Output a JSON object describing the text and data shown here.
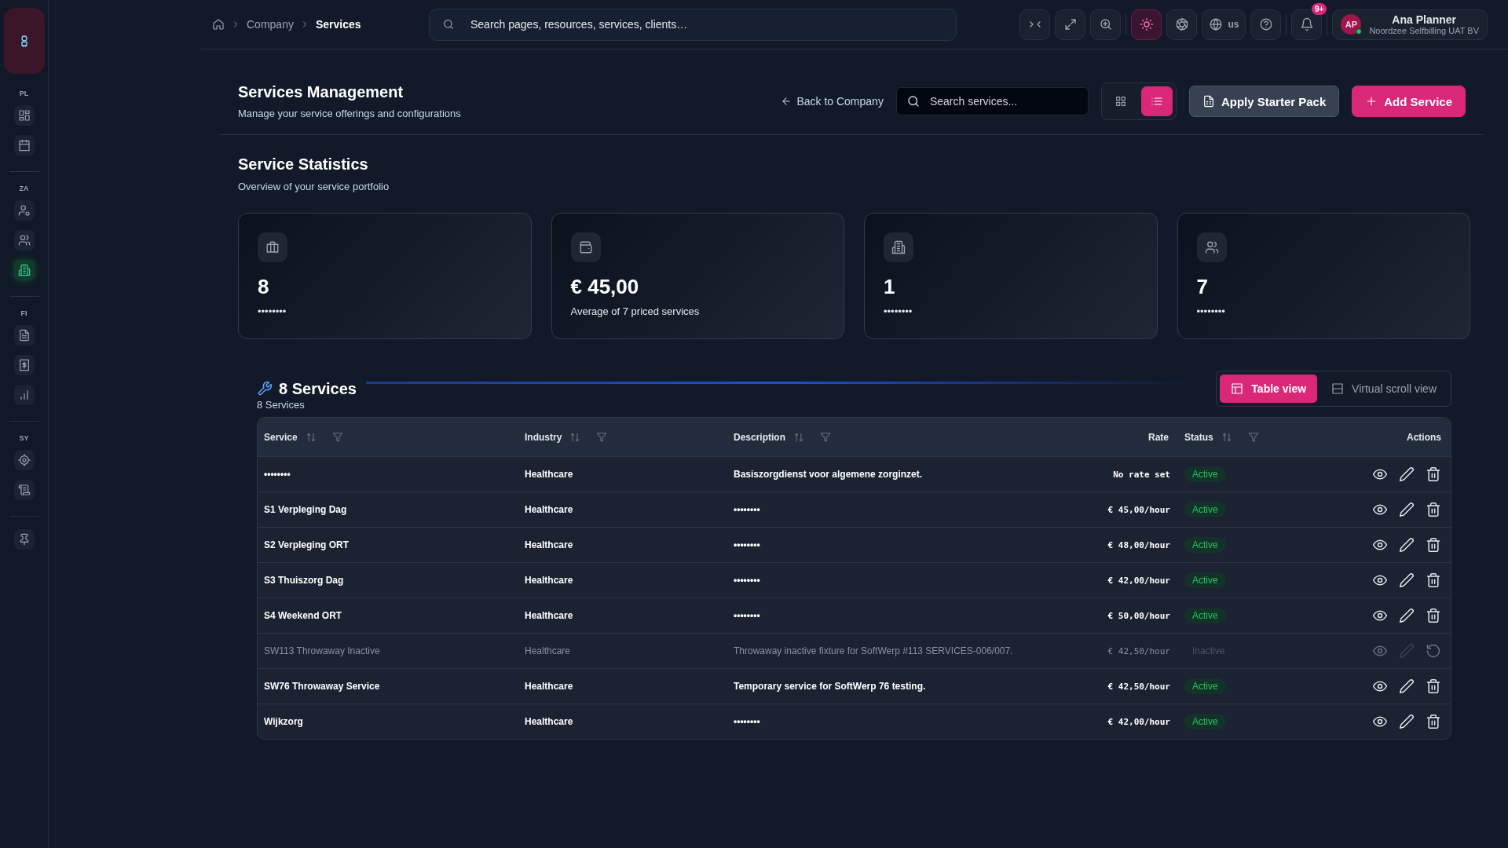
{
  "sidebar": {
    "sections": [
      {
        "label": "PL",
        "items": [
          {
            "selected": false
          },
          {
            "selected": false
          }
        ]
      },
      {
        "label": "ZA",
        "items": [
          {
            "selected": false
          },
          {
            "selected": false
          },
          {
            "selected": true
          }
        ]
      },
      {
        "label": "FI",
        "items": [
          {
            "selected": false
          },
          {
            "selected": false
          },
          {
            "selected": false
          }
        ]
      },
      {
        "label": "SY",
        "items": [
          {
            "selected": false
          },
          {
            "selected": false
          }
        ]
      }
    ]
  },
  "topbar": {
    "breadcrumb": [
      "Company",
      "Services"
    ],
    "search": {
      "placeholder": "Search pages, resources, services, clients…"
    },
    "theme_toggle": {
      "on": true
    },
    "language": "us",
    "notifications_badge": "9+",
    "user": {
      "initials": "AP",
      "name": "Ana Planner",
      "organization": "Noordzee Selfbilling UAT BV"
    }
  },
  "page_header": {
    "title": "Services Management",
    "subtitle": "Manage your service offerings and configurations",
    "back_link": "Back to Company",
    "search": {
      "placeholder": "Search services..."
    },
    "view_modes": [
      {
        "selected": false
      },
      {
        "selected": true
      }
    ],
    "buttons": [
      "Apply Starter Pack",
      "Add Service"
    ]
  },
  "statistics": {
    "title": "Service Statistics",
    "subtitle": "Overview of your service portfolio",
    "cards": [
      {
        "value": "8",
        "label": "••••••••"
      },
      {
        "value": "€ 45,00",
        "label": "Average of 7 priced services"
      },
      {
        "value": "1",
        "label": "••••••••"
      },
      {
        "value": "7",
        "label": "••••••••"
      }
    ]
  },
  "services": {
    "title": "8 Services",
    "subtitle": "8 Services",
    "views": [
      {
        "label": "Table view",
        "selected": true
      },
      {
        "label": "Virtual scroll view",
        "selected": false
      }
    ],
    "table": {
      "columns": [
        {
          "label": "Service",
          "sortable": true
        },
        {
          "label": "Industry",
          "sortable": true
        },
        {
          "label": "Description",
          "sortable": true
        },
        {
          "label": "Rate",
          "sortable": false
        },
        {
          "label": "Status",
          "sortable": true
        },
        {
          "label": "Actions",
          "sortable": false
        }
      ],
      "rows": [
        {
          "service": "••••••••",
          "industry": "Healthcare",
          "description": "Basiszorgdienst voor algemene zorginzet.",
          "rate": "No rate set",
          "status": "Active",
          "active": true
        },
        {
          "service": "S1 Verpleging Dag",
          "industry": "Healthcare",
          "description": "••••••••",
          "rate": "€ 45,00/hour",
          "status": "Active",
          "active": true
        },
        {
          "service": "S2 Verpleging ORT",
          "industry": "Healthcare",
          "description": "••••••••",
          "rate": "€ 48,00/hour",
          "status": "Active",
          "active": true
        },
        {
          "service": "S3 Thuiszorg Dag",
          "industry": "Healthcare",
          "description": "••••••••",
          "rate": "€ 42,00/hour",
          "status": "Active",
          "active": true
        },
        {
          "service": "S4 Weekend ORT",
          "industry": "Healthcare",
          "description": "••••••••",
          "rate": "€ 50,00/hour",
          "status": "Active",
          "active": true
        },
        {
          "service": "SW113 Throwaway Inactive",
          "industry": "Healthcare",
          "description": "Throwaway inactive fixture for SoftWerp #113 SERVICES-006/007.",
          "rate": "€ 42,50/hour",
          "status": "Inactive",
          "active": false
        },
        {
          "service": "SW76 Throwaway Service",
          "industry": "Healthcare",
          "description": "Temporary service for SoftWerp 76 testing.",
          "rate": "€ 42,50/hour",
          "status": "Active",
          "active": true
        },
        {
          "service": "Wijkzorg",
          "industry": "Healthcare",
          "description": "••••••••",
          "rate": "€ 42,00/hour",
          "status": "Active",
          "active": true
        }
      ]
    }
  }
}
